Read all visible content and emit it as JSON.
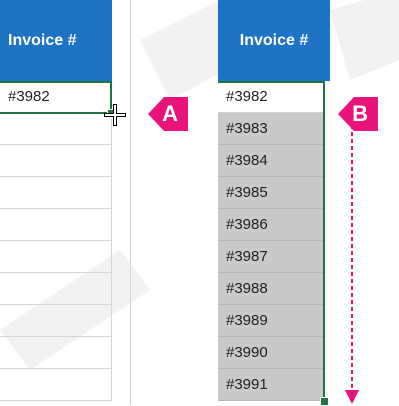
{
  "panel_a": {
    "header": "Invoice #",
    "cells": [
      "#3982"
    ],
    "badge": "A"
  },
  "panel_b": {
    "header": "Invoice #",
    "cells": [
      "#3982",
      "#3983",
      "#3984",
      "#3985",
      "#3986",
      "#3987",
      "#3988",
      "#3989",
      "#3990",
      "#3991"
    ],
    "badge": "B"
  },
  "colors": {
    "header": "#1f73c4",
    "selection_border": "#217346",
    "badge": "#e8147a",
    "selected_fill": "#c9c9c9"
  },
  "icons": [
    "crosshair-cursor-icon",
    "dashed-down-arrow-icon"
  ]
}
